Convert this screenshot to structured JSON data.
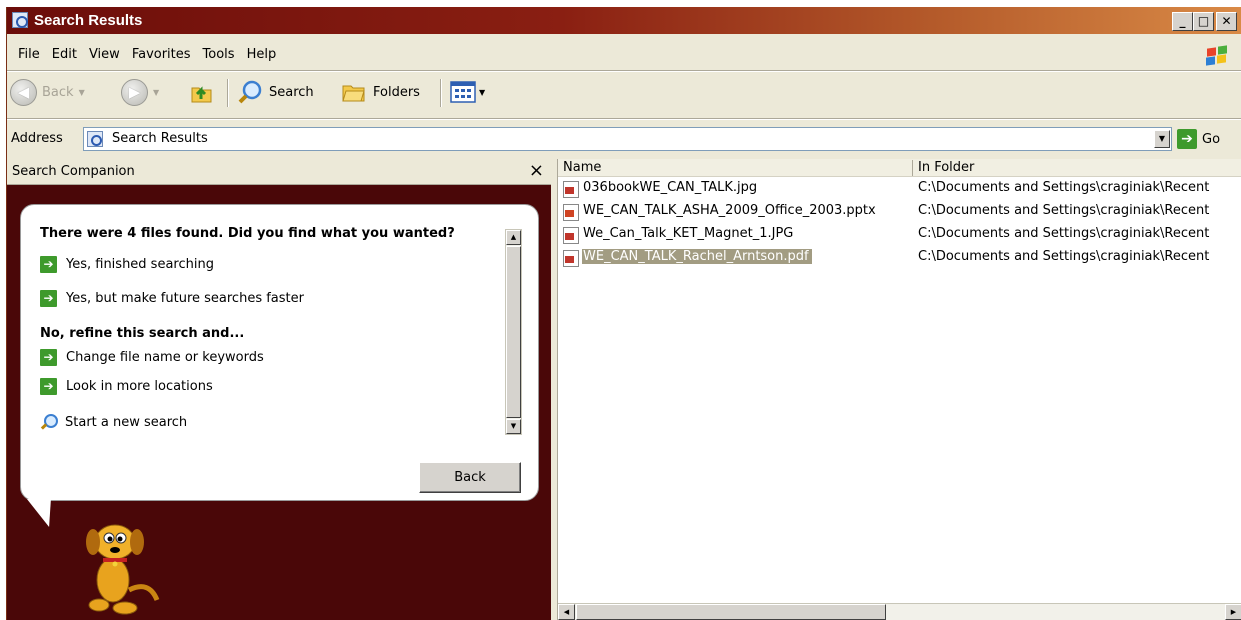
{
  "window": {
    "title": "Search Results",
    "caption_buttons": [
      "_",
      "□",
      "✕"
    ]
  },
  "menu": [
    "File",
    "Edit",
    "View",
    "Favorites",
    "Tools",
    "Help"
  ],
  "toolbar": {
    "back_label": "Back",
    "search_label": "Search",
    "folders_label": "Folders"
  },
  "address": {
    "label": "Address",
    "value": "Search Results",
    "go_label": "Go"
  },
  "companion": {
    "header": "Search Companion",
    "close_glyph": "×",
    "heading": "There were 4 files found. Did you find what you wanted?",
    "link_finished": "Yes, finished searching",
    "link_faster": "Yes, but make future searches faster",
    "refine_heading": "No, refine this search and...",
    "link_change_name": "Change file name or keywords",
    "link_more_locations": "Look in more locations",
    "link_new_search": "Start a new search",
    "back_button": "Back"
  },
  "file_list": {
    "columns": [
      "Name",
      "In Folder"
    ],
    "rows": [
      {
        "name": "036bookWE_CAN_TALK.jpg",
        "folder": "C:\\Documents and Settings\\craginiak\\Recent",
        "icon": "shortcut-image-icon"
      },
      {
        "name": "WE_CAN_TALK_ASHA_2009_Office_2003.pptx",
        "folder": "C:\\Documents and Settings\\craginiak\\Recent",
        "icon": "shortcut-powerpoint-icon"
      },
      {
        "name": "We_Can_Talk_KET_Magnet_1.JPG",
        "folder": "C:\\Documents and Settings\\craginiak\\Recent",
        "icon": "shortcut-image-icon"
      },
      {
        "name": "WE_CAN_TALK_Rachel_Arntson.pdf",
        "folder": "C:\\Documents and Settings\\craginiak\\Recent",
        "icon": "shortcut-pdf-icon",
        "selected": true
      }
    ]
  }
}
